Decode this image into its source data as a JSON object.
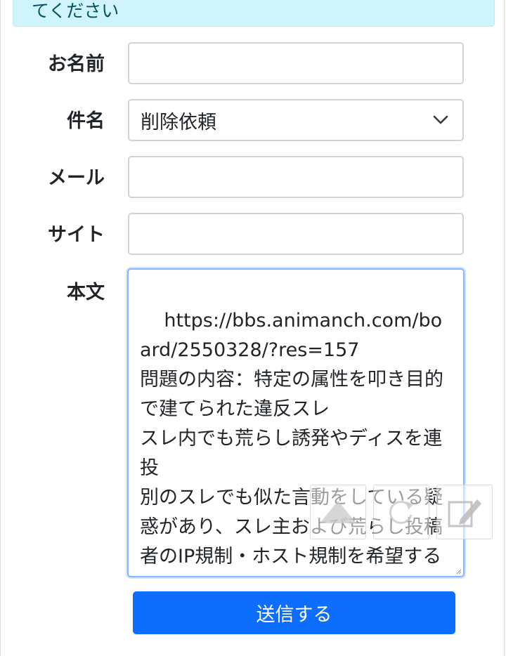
{
  "alert": {
    "text": "てください"
  },
  "form": {
    "name": {
      "label": "お名前",
      "value": ""
    },
    "subject": {
      "label": "件名",
      "selected": "削除依頼"
    },
    "mail": {
      "label": "メール",
      "value": ""
    },
    "site": {
      "label": "サイト",
      "value": ""
    },
    "body": {
      "label": "本文",
      "value": "https://bbs.animanch.com/board/2550328/?res=157\n問題の内容：特定の属性を叩き目的で建てられた違反スレ\nスレ内でも荒らし誘発やディスを連投\n別のスレでも似た言動をしている疑惑があり、スレ主および荒らし投稿者のIP規制・ホスト規制を希望する"
    },
    "submit_label": "送信する"
  },
  "overlay": {
    "icons": [
      "arrow-up-icon",
      "refresh-icon",
      "edit-icon"
    ]
  },
  "colors": {
    "primary": "#0d6efd",
    "alert_bg": "#cff4fc",
    "focus_border": "#86b7fe"
  }
}
